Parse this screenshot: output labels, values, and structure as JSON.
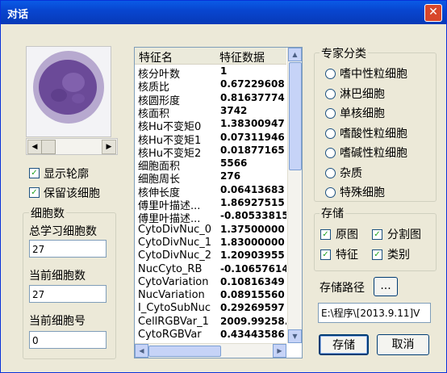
{
  "window": {
    "title": "对话",
    "close_glyph": "✕"
  },
  "left": {
    "scroll_left": "◀",
    "scroll_right": "▶",
    "show_contour_label": "显示轮廓",
    "keep_cell_label": "保留该细胞",
    "cell_count_group": "细胞数",
    "total_learned_label": "总学习细胞数",
    "total_learned_value": "27",
    "current_count_label": "当前细胞数",
    "current_count_value": "27",
    "current_index_label": "当前细胞号",
    "current_index_value": "0"
  },
  "features": {
    "col_name": "特征名",
    "col_value": "特征数据",
    "rows": [
      [
        "核分叶数",
        "1"
      ],
      [
        "核质比",
        "0.67229608"
      ],
      [
        "核圆形度",
        "0.81637774"
      ],
      [
        "核面积",
        "3742"
      ],
      [
        "核Hu不变矩0",
        "1.38300947"
      ],
      [
        "核Hu不变矩1",
        "0.07311946"
      ],
      [
        "核Hu不变矩2",
        "0.01877165"
      ],
      [
        "细胞面积",
        "5566"
      ],
      [
        "细胞周长",
        "276"
      ],
      [
        "核伸长度",
        "0.06413683"
      ],
      [
        "傅里叶描述...",
        "1.86927515"
      ],
      [
        "傅里叶描述...",
        "-0.80533815"
      ],
      [
        "CytoDivNuc_0",
        "1.37500000"
      ],
      [
        "CytoDivNuc_1",
        "1.83000000"
      ],
      [
        "CytoDivNuc_2",
        "1.20903955"
      ],
      [
        "NucCyto_RB",
        "-0.10657614"
      ],
      [
        "CytoVariation",
        "0.10816349"
      ],
      [
        "NucVariation",
        "0.08915560"
      ],
      [
        "I_CytoSubNuc",
        "0.29269597"
      ],
      [
        "CellRGBVar_1",
        "2009.99258..."
      ],
      [
        "CytoRGBVar",
        "0.43443586"
      ]
    ]
  },
  "expert": {
    "group": "专家分类",
    "options": [
      "嗜中性粒细胞",
      "淋巴细胞",
      "单核细胞",
      "嗜酸性粒细胞",
      "嗜碱性粒细胞",
      "杂质",
      "特殊细胞"
    ]
  },
  "storage": {
    "group": "存储",
    "original": "原图",
    "segmented": "分割图",
    "feature": "特征",
    "category": "类别",
    "path_label": "存储路径",
    "browse": "...",
    "path_value": "E:\\程序\\[2013.9.11]V",
    "save": "存储",
    "cancel": "取消"
  }
}
